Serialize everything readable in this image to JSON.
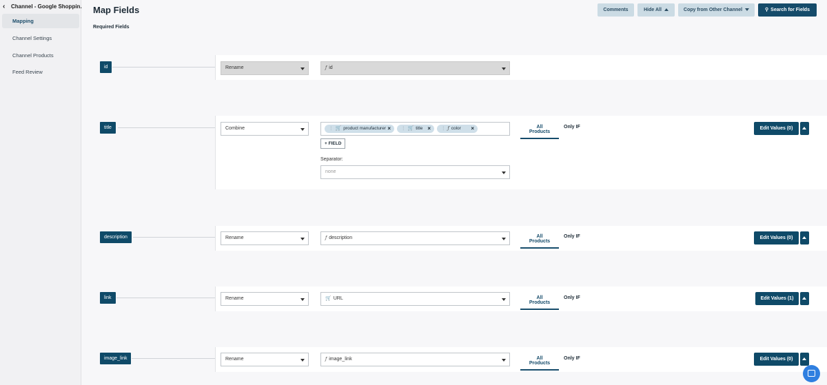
{
  "sidebar": {
    "back_label": "Channel - Google Shoppin...",
    "items": [
      {
        "label": "Mapping"
      },
      {
        "label": "Channel Settings"
      },
      {
        "label": "Channel Products"
      },
      {
        "label": "Feed Review"
      }
    ]
  },
  "header": {
    "title": "Map Fields",
    "section": "Required Fields",
    "buttons": {
      "comments": "Comments",
      "hide_all": "Hide All",
      "copy": "Copy from Other Channel",
      "search": "Search for Fields"
    }
  },
  "tabs": {
    "all": "All Products",
    "only_if": "Only IF"
  },
  "rows": [
    {
      "tag": "id",
      "method": "Rename",
      "value": "id",
      "value_icon": "f-icon"
    },
    {
      "tag": "title",
      "method": "Combine",
      "chips": [
        "product manufacturer",
        "title",
        "color"
      ],
      "add_field": "FIELD",
      "separator_label": "Separator:",
      "separator_value": "none",
      "edit_values": "Edit Values (0)"
    },
    {
      "tag": "description",
      "method": "Rename",
      "value": "description",
      "value_icon": "f-icon",
      "edit_values": "Edit Values (0)"
    },
    {
      "tag": "link",
      "method": "Rename",
      "value": "URL",
      "value_icon": "cart-icon",
      "edit_values": "Edit Values (1)"
    },
    {
      "tag": "image_link",
      "method": "Rename",
      "value": "image_link",
      "value_icon": "f-icon",
      "edit_values": "Edit Values (0)"
    }
  ]
}
